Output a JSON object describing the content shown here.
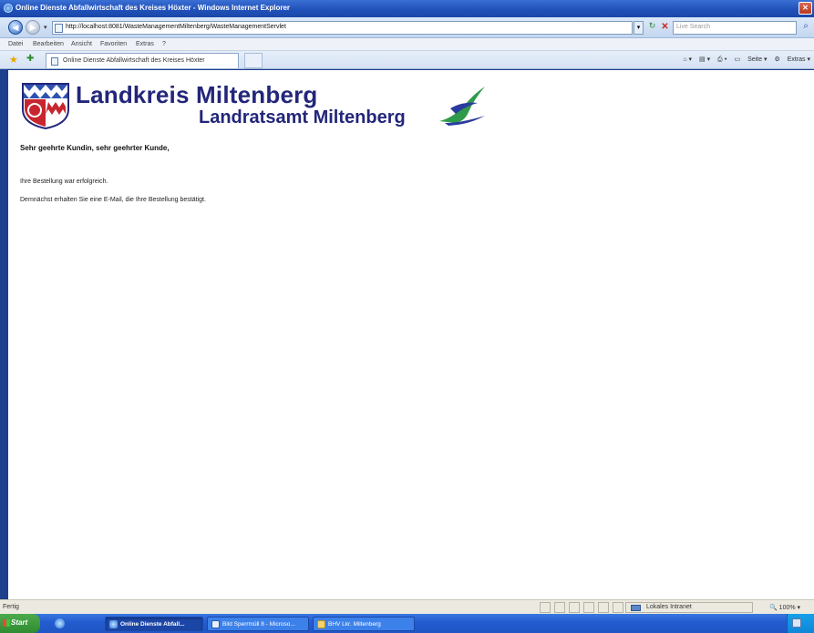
{
  "window": {
    "title": "Online Dienste Abfallwirtschaft des Kreises Höxter - Windows Internet Explorer"
  },
  "nav": {
    "address": "http://localhost:8081/WasteManagementMiltenberg/WasteManagementServlet",
    "search_placeholder": "Live Search"
  },
  "menu": {
    "items": [
      "Datei",
      "Bearbeiten",
      "Ansicht",
      "Favoriten",
      "Extras",
      "?"
    ]
  },
  "tabs": {
    "active_label": "Online Dienste Abfallwirtschaft des Kreises Höxter"
  },
  "commandbar": {
    "items": [
      "Seite",
      "Extras"
    ]
  },
  "page": {
    "brand_main": "Landkreis Miltenberg",
    "brand_sub": "Landratsamt Miltenberg",
    "greeting": "Sehr geehrte Kundin, sehr geehrter Kunde,",
    "message_1": "Ihre Bestellung war erfolgreich.",
    "message_2": "Demnächst erhalten Sie eine E-Mail, die Ihre Bestellung bestätigt."
  },
  "status": {
    "text": "Fertig",
    "zone": "Lokales Intranet",
    "zoom": "100%"
  },
  "taskbar": {
    "start_label": "Start",
    "tasks": [
      "Online Dienste Abfall...",
      "Bild Sperrmüll 8 - Microso...",
      "BHV Lkr. Miltenberg"
    ]
  },
  "colors": {
    "brand": "#23267a",
    "titlebar": "#1f4fb8",
    "taskbar": "#245dd0"
  }
}
